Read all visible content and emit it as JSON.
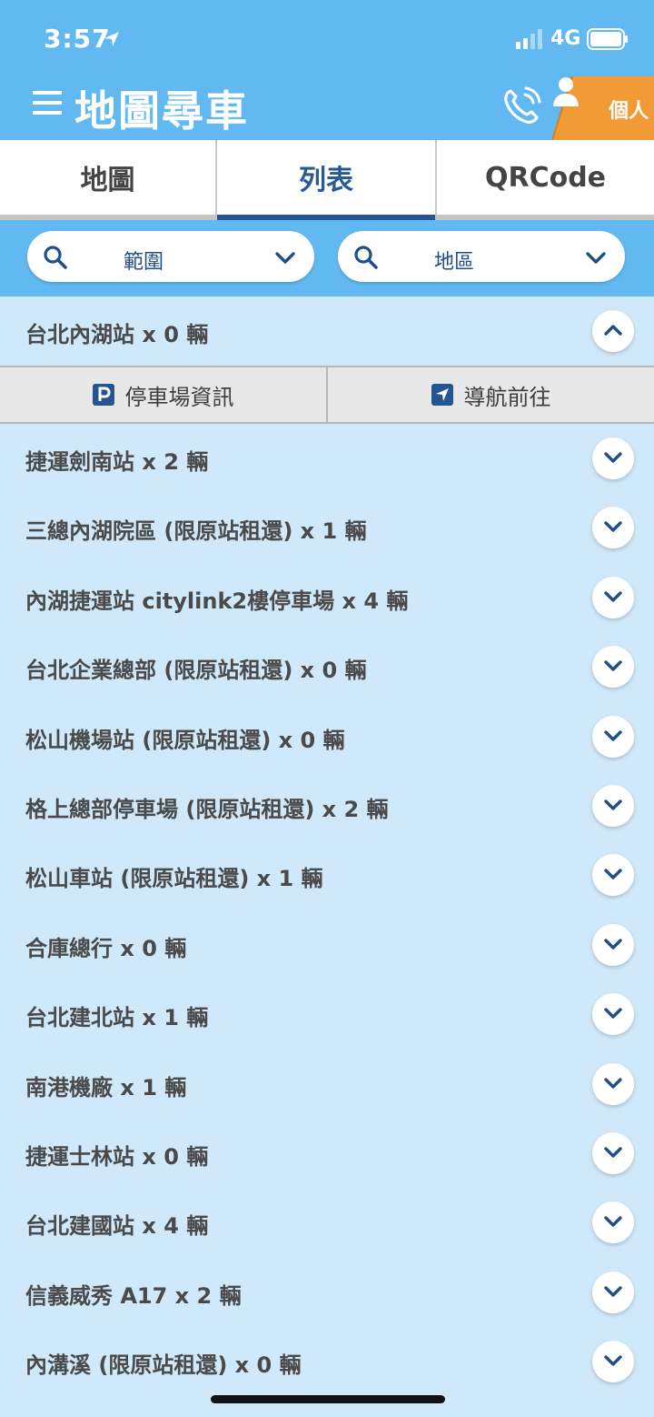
{
  "status_bar": {
    "time": "3:57",
    "network": "4G"
  },
  "header": {
    "title": "地圖尋車",
    "profile_label": "個人"
  },
  "tabs": [
    {
      "label": "地圖",
      "active": false
    },
    {
      "label": "列表",
      "active": true
    },
    {
      "label": "QRCode",
      "active": false
    }
  ],
  "filters": {
    "range_label": "範圍",
    "area_label": "地區"
  },
  "expanded_item": {
    "label": "台北內湖站 x 0 輛",
    "actions": {
      "parking_info": "停車場資訊",
      "navigate": "導航前往"
    }
  },
  "stations": [
    "捷運劍南站 x 2 輛",
    "三總內湖院區 (限原站租還) x 1 輛",
    "內湖捷運站 citylink2樓停車場 x 4 輛",
    "台北企業總部 (限原站租還) x 0 輛",
    "松山機場站 (限原站租還) x 0 輛",
    "格上總部停車場 (限原站租還) x 2 輛",
    "松山車站 (限原站租還) x 1 輛",
    "合庫總行 x 0 輛",
    "台北建北站 x 1 輛",
    "南港機廠 x 1 輛",
    "捷運士林站 x 0 輛",
    "台北建國站 x 4 輛",
    "信義威秀 A17 x 2 輛",
    "內溝溪 (限原站租還) x 0 輛"
  ],
  "colors": {
    "header_blue": "#62b9f1",
    "list_bg": "#cfe8fa",
    "accent_navy": "#245592",
    "profile_orange": "#f29a36"
  }
}
